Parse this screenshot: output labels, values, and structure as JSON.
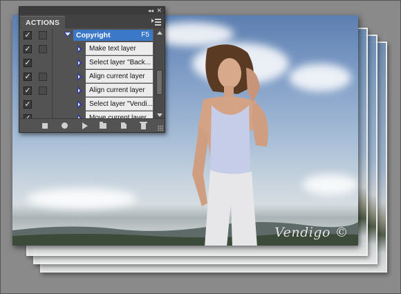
{
  "panel": {
    "tab_label": "ACTIONS",
    "topbar": {
      "collapse_glyph": "◂◂",
      "close_glyph": "✕"
    },
    "menu_icon": "panel-menu-icon",
    "action": {
      "name": "Copyright",
      "shortcut": "F5"
    },
    "steps": [
      {
        "label": "Make text layer"
      },
      {
        "label": "Select layer \"Back..."
      },
      {
        "label": "Align current layer"
      },
      {
        "label": "Align current layer"
      },
      {
        "label": "Select layer \"Vendi..."
      },
      {
        "label": "Move current layer"
      }
    ],
    "toolbar": [
      "stop-icon",
      "record-icon",
      "play-icon",
      "new-set-icon",
      "new-action-icon",
      "delete-icon"
    ]
  },
  "photo": {
    "watermark": "Vendigo ©"
  },
  "colors": {
    "panel_bg": "#535353",
    "highlight": "#3b78c8",
    "step_bg": "#ececec"
  }
}
